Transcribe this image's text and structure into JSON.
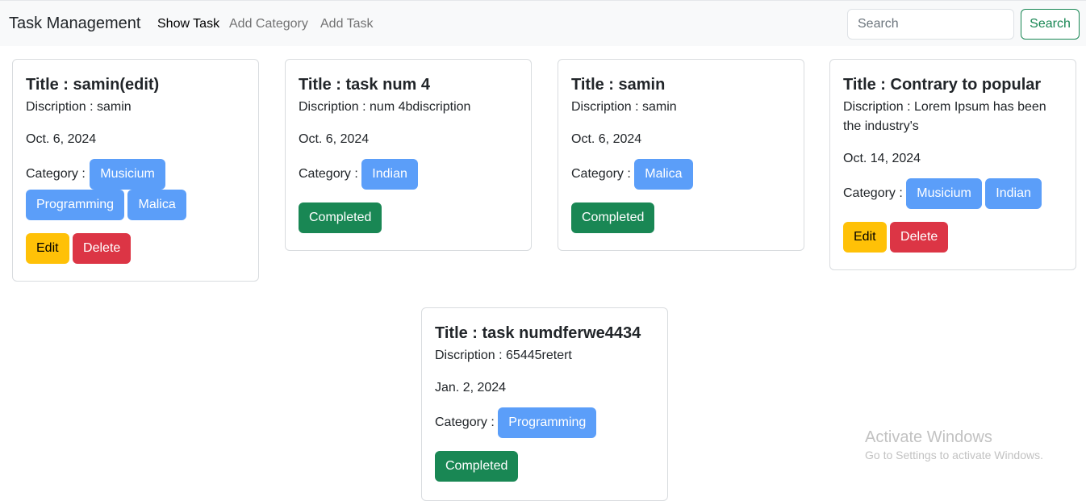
{
  "navbar": {
    "brand": "Task Management",
    "links": [
      "Show Task",
      "Add Category",
      "Add Task"
    ],
    "search_placeholder": "Search",
    "search_button": "Search"
  },
  "tasks": [
    {
      "title": "Title : samin(edit)",
      "description": "Discription : samin",
      "date": "Oct. 6, 2024",
      "category_label": "Category :",
      "categories": [
        "Musicium",
        "Programming",
        "Malica"
      ],
      "edit": "Edit",
      "delete": "Delete"
    },
    {
      "title": "Title : task num 4",
      "description": "Discription : num 4bdiscription",
      "date": "Oct. 6, 2024",
      "category_label": "Category :",
      "categories": [
        "Indian"
      ],
      "status": "Completed"
    },
    {
      "title": "Title : samin",
      "description": "Discription : samin",
      "date": "Oct. 6, 2024",
      "category_label": "Category :",
      "categories": [
        "Malica"
      ],
      "status": "Completed"
    },
    {
      "title": "Title : Contrary to popular",
      "description": "Discription : Lorem Ipsum has been the industry's",
      "date": "Oct. 14, 2024",
      "category_label": "Category :",
      "categories": [
        "Musicium",
        "Indian"
      ],
      "edit": "Edit",
      "delete": "Delete"
    },
    {
      "title": "Title : task numdferwe4434",
      "description": "Discription : 65445retert",
      "date": "Jan. 2, 2024",
      "category_label": "Category :",
      "categories": [
        "Programming"
      ],
      "status": "Completed"
    }
  ],
  "watermark": {
    "title": "Activate Windows",
    "subtitle": "Go to Settings to activate Windows."
  }
}
